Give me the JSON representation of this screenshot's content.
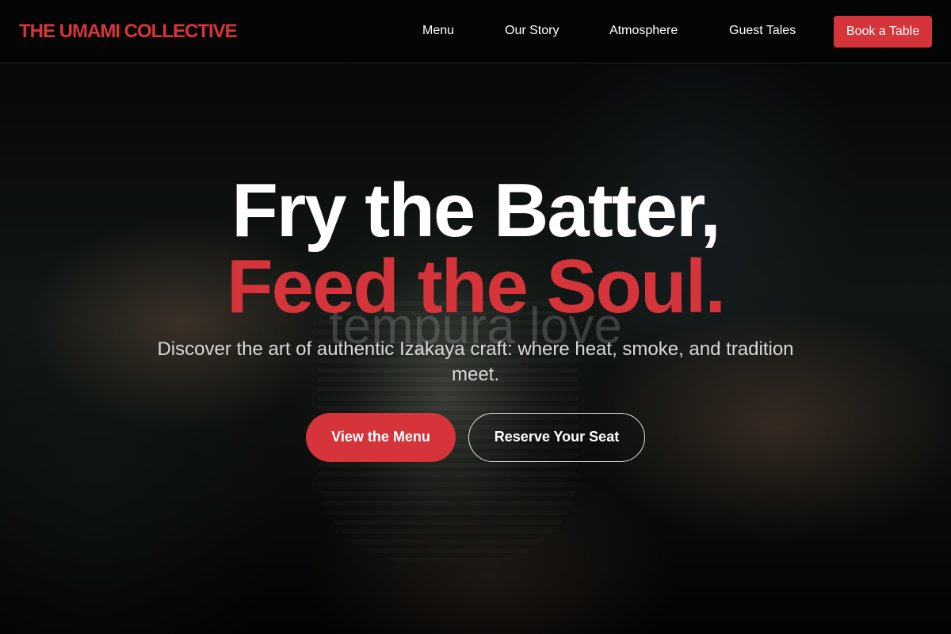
{
  "header": {
    "brand": "THE UMAMI COLLECTIVE",
    "nav": {
      "menu": "Menu",
      "story": "Our Story",
      "atmosphere": "Atmosphere",
      "tales": "Guest Tales"
    },
    "cta": "Book a Table"
  },
  "hero": {
    "headline_line1": "Fry the Batter,",
    "headline_line2": "Feed the Soul.",
    "watermark": "tempura love",
    "subtitle": "Discover the art of authentic Izakaya craft: where heat, smoke, and tradition meet.",
    "primary_button": "View the Menu",
    "secondary_button": "Reserve Your Seat"
  },
  "colors": {
    "accent": "#d5343a",
    "background": "#050505",
    "text": "#ffffff"
  }
}
